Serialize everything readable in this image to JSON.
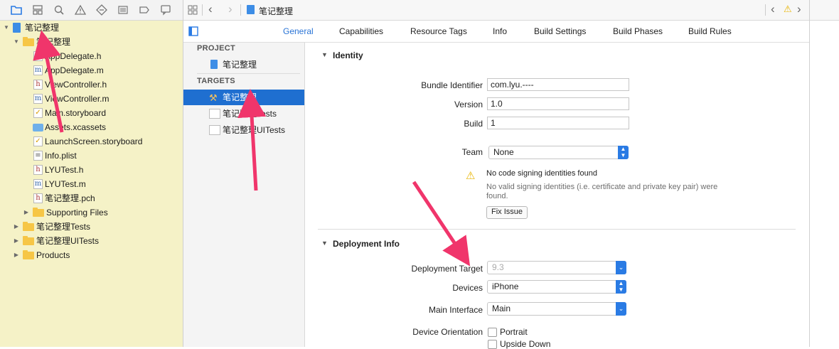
{
  "navigator": {
    "toolbar_icons": [
      "folder-icon",
      "hierarchy-icon",
      "search-icon",
      "warning-icon",
      "test-diamond-icon",
      "list-icon",
      "breakpoint-icon",
      "comment-icon"
    ],
    "tree": [
      {
        "label": "笔记整理",
        "kind": "project",
        "indent": 0,
        "disclosure": "open"
      },
      {
        "label": "笔记整理",
        "kind": "folder",
        "indent": 1,
        "disclosure": "open"
      },
      {
        "label": "AppDelegate.h",
        "kind": "h",
        "indent": 2
      },
      {
        "label": "AppDelegate.m",
        "kind": "m",
        "indent": 2
      },
      {
        "label": "ViewController.h",
        "kind": "h",
        "indent": 2
      },
      {
        "label": "ViewController.m",
        "kind": "m",
        "indent": 2
      },
      {
        "label": "Main.storyboard",
        "kind": "storyboard",
        "indent": 2
      },
      {
        "label": "Assets.xcassets",
        "kind": "assets",
        "indent": 2
      },
      {
        "label": "LaunchScreen.storyboard",
        "kind": "storyboard",
        "indent": 2
      },
      {
        "label": "Info.plist",
        "kind": "plist",
        "indent": 2
      },
      {
        "label": "LYUTest.h",
        "kind": "h",
        "indent": 2
      },
      {
        "label": "LYUTest.m",
        "kind": "m",
        "indent": 2
      },
      {
        "label": "笔记整理.pch",
        "kind": "h",
        "indent": 2
      },
      {
        "label": "Supporting Files",
        "kind": "folder",
        "indent": 2,
        "disclosure": "closed"
      },
      {
        "label": "笔记整理Tests",
        "kind": "folder",
        "indent": 1,
        "disclosure": "closed"
      },
      {
        "label": "笔记整理UITests",
        "kind": "folder",
        "indent": 1,
        "disclosure": "closed"
      },
      {
        "label": "Products",
        "kind": "folder",
        "indent": 1,
        "disclosure": "closed"
      }
    ]
  },
  "jump_bar": {
    "title": "笔记整理"
  },
  "tabs": [
    "General",
    "Capabilities",
    "Resource Tags",
    "Info",
    "Build Settings",
    "Build Phases",
    "Build Rules"
  ],
  "active_tab": "General",
  "targets_panel": {
    "project_header": "PROJECT",
    "project_item": "笔记整理",
    "targets_header": "TARGETS",
    "targets": [
      "笔记整理",
      "笔记整理Tests",
      "笔记整理UITests"
    ]
  },
  "identity": {
    "section_title": "Identity",
    "bundle_identifier_label": "Bundle Identifier",
    "bundle_identifier": "com.lyu.----",
    "version_label": "Version",
    "version": "1.0",
    "build_label": "Build",
    "build": "1",
    "team_label": "Team",
    "team": "None",
    "warning_title": "No code signing identities found",
    "warning_detail": "No valid signing identities (i.e. certificate and private key pair) were found.",
    "fix_button": "Fix Issue"
  },
  "deployment": {
    "section_title": "Deployment Info",
    "target_label": "Deployment Target",
    "target": "9.3",
    "devices_label": "Devices",
    "devices": "iPhone",
    "main_interface_label": "Main Interface",
    "main_interface": "Main",
    "orientation_label": "Device Orientation",
    "orientations": [
      "Portrait",
      "Upside Down"
    ]
  },
  "colors": {
    "accent": "#2a74d6",
    "selection": "#1f6fd0",
    "annotation_arrow": "#f0356b",
    "navigator_bg": "#f5f2c7"
  }
}
